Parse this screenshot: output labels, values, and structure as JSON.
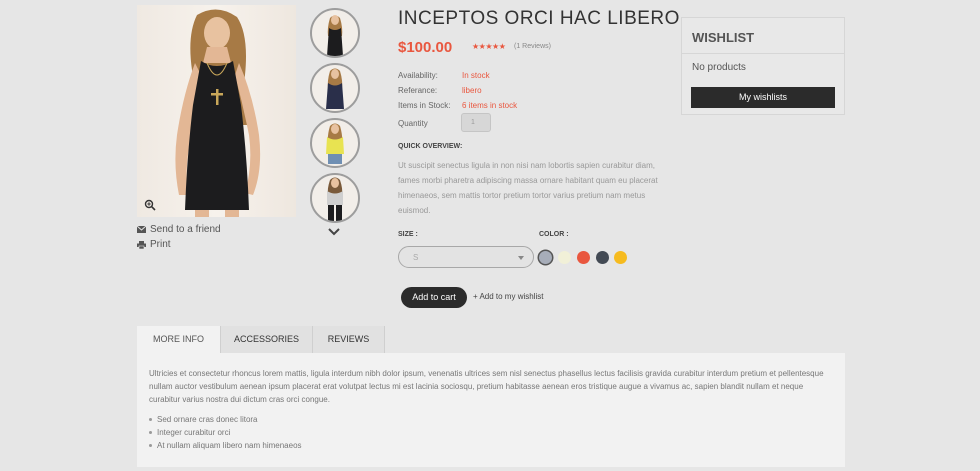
{
  "product": {
    "title": "INCEPTOS ORCI HAC LIBERO",
    "price": "$100.00",
    "stars": "★★★★★",
    "reviews_count": "(1 Reviews)",
    "info": [
      {
        "label": "Availability:",
        "value": "In stock"
      },
      {
        "label": "Referance:",
        "value": "libero"
      },
      {
        "label": "Items in Stock:",
        "value": "6 items in stock"
      }
    ],
    "quantity_label": "Quantity",
    "quantity_value": "1",
    "overview_heading": "QUICK OVERVIEW:",
    "overview_text": "Ut suscipit senectus ligula in non nisi nam lobortis sapien curabitur diam, fames morbi pharetra adipiscing massa ornare habitant quam eu placerat himenaeos, sem mattis tortor pretium tortor varius pretium nam metus euismod.",
    "size_label": "SIZE :",
    "size_value": "S",
    "color_label": "COLOR :",
    "colors": [
      "#a7adb9",
      "#f1f0d8",
      "#e9573f",
      "#434a54",
      "#f6bb1f"
    ],
    "add_to_cart": "Add to cart",
    "add_to_wishlist": "+ Add to my wishlist"
  },
  "side_links": {
    "send_friend": "Send to a friend",
    "print": "Print"
  },
  "wishlist": {
    "title": "WISHLIST",
    "empty_text": "No products",
    "button": "My wishlists"
  },
  "tabs": [
    {
      "label": "MORE INFO",
      "active": true
    },
    {
      "label": "ACCESSORIES",
      "active": false
    },
    {
      "label": "REVIEWS",
      "active": false
    }
  ],
  "more_info": {
    "paragraph": "Ultricies et consectetur rhoncus lorem mattis, ligula interdum nibh dolor ipsum, venenatis ultrices sem nisl senectus phasellus lectus facilisis gravida curabitur interdum pretium et pellentesque nullam auctor vestibulum aenean ipsum placerat erat volutpat lectus mi est lacinia sociosqu, pretium habitasse aenean eros tristique augue a vivamus ac, sapien blandit nullam et neque curabitur varius nostra dui dictum cras orci congue.",
    "bullets": [
      "Sed ornare cras donec litora",
      "Integer curabitur orci",
      "At nullam aliquam libero nam himenaeos"
    ]
  }
}
